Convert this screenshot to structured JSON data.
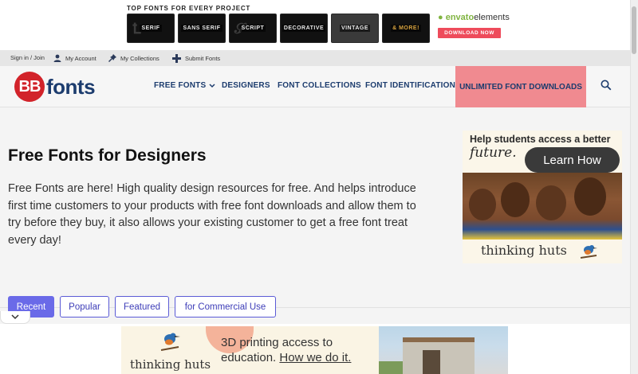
{
  "promo": {
    "title": "TOP FONTS FOR EVERY PROJECT",
    "tiles": [
      {
        "label": "SERIF",
        "icon": "serif-tile"
      },
      {
        "label": "SANS SERIF",
        "icon": "sans-serif-tile"
      },
      {
        "label": "SCRIPT",
        "icon": "script-tile"
      },
      {
        "label": "DECORATIVE",
        "icon": "decorative-tile"
      },
      {
        "label": "VINTAGE",
        "icon": "vintage-tile"
      },
      {
        "label": "& MORE!",
        "icon": "more-tile"
      }
    ],
    "envato_a": "envato",
    "envato_b": "elements",
    "download": "DOWNLOAD NOW"
  },
  "util": {
    "signin": "Sign in / Join",
    "account": "My Account",
    "collections": "My Collections",
    "submit": "Submit Fonts"
  },
  "logo": {
    "mark": "BB",
    "text": "fonts"
  },
  "nav": {
    "free_fonts": "FREE FONTS",
    "designers": "DESIGNERS",
    "collections": "FONT COLLECTIONS",
    "identification": "FONT IDENTIFICATION",
    "unlimited": "UNLIMITED FONT DOWNLOADS"
  },
  "main": {
    "heading": "Free Fonts for Designers",
    "intro": "Free Fonts are here! High quality design resources for free. And helps introduce first time customers to your products with free font downloads and allow them to try before they buy, it also allows your existing customer to get a free font treat every day!"
  },
  "ad_right": {
    "head": "Help students access a better",
    "future": "future.",
    "button": "Learn How",
    "brand": "thinking huts"
  },
  "tabs": [
    {
      "label": "Recent",
      "active": true
    },
    {
      "label": "Popular",
      "active": false
    },
    {
      "label": "Featured",
      "active": false
    },
    {
      "label": "for Commercial Use",
      "active": false
    }
  ],
  "ad_bottom": {
    "brand": "thinking huts",
    "line1": "3D printing access to",
    "line2a": "education. ",
    "line2b": "How we do it."
  },
  "colors": {
    "accent": "#6a6ae8",
    "nav_text": "#1c3c6e",
    "highlight": "#f08a90",
    "logo_red": "#d2232a"
  }
}
